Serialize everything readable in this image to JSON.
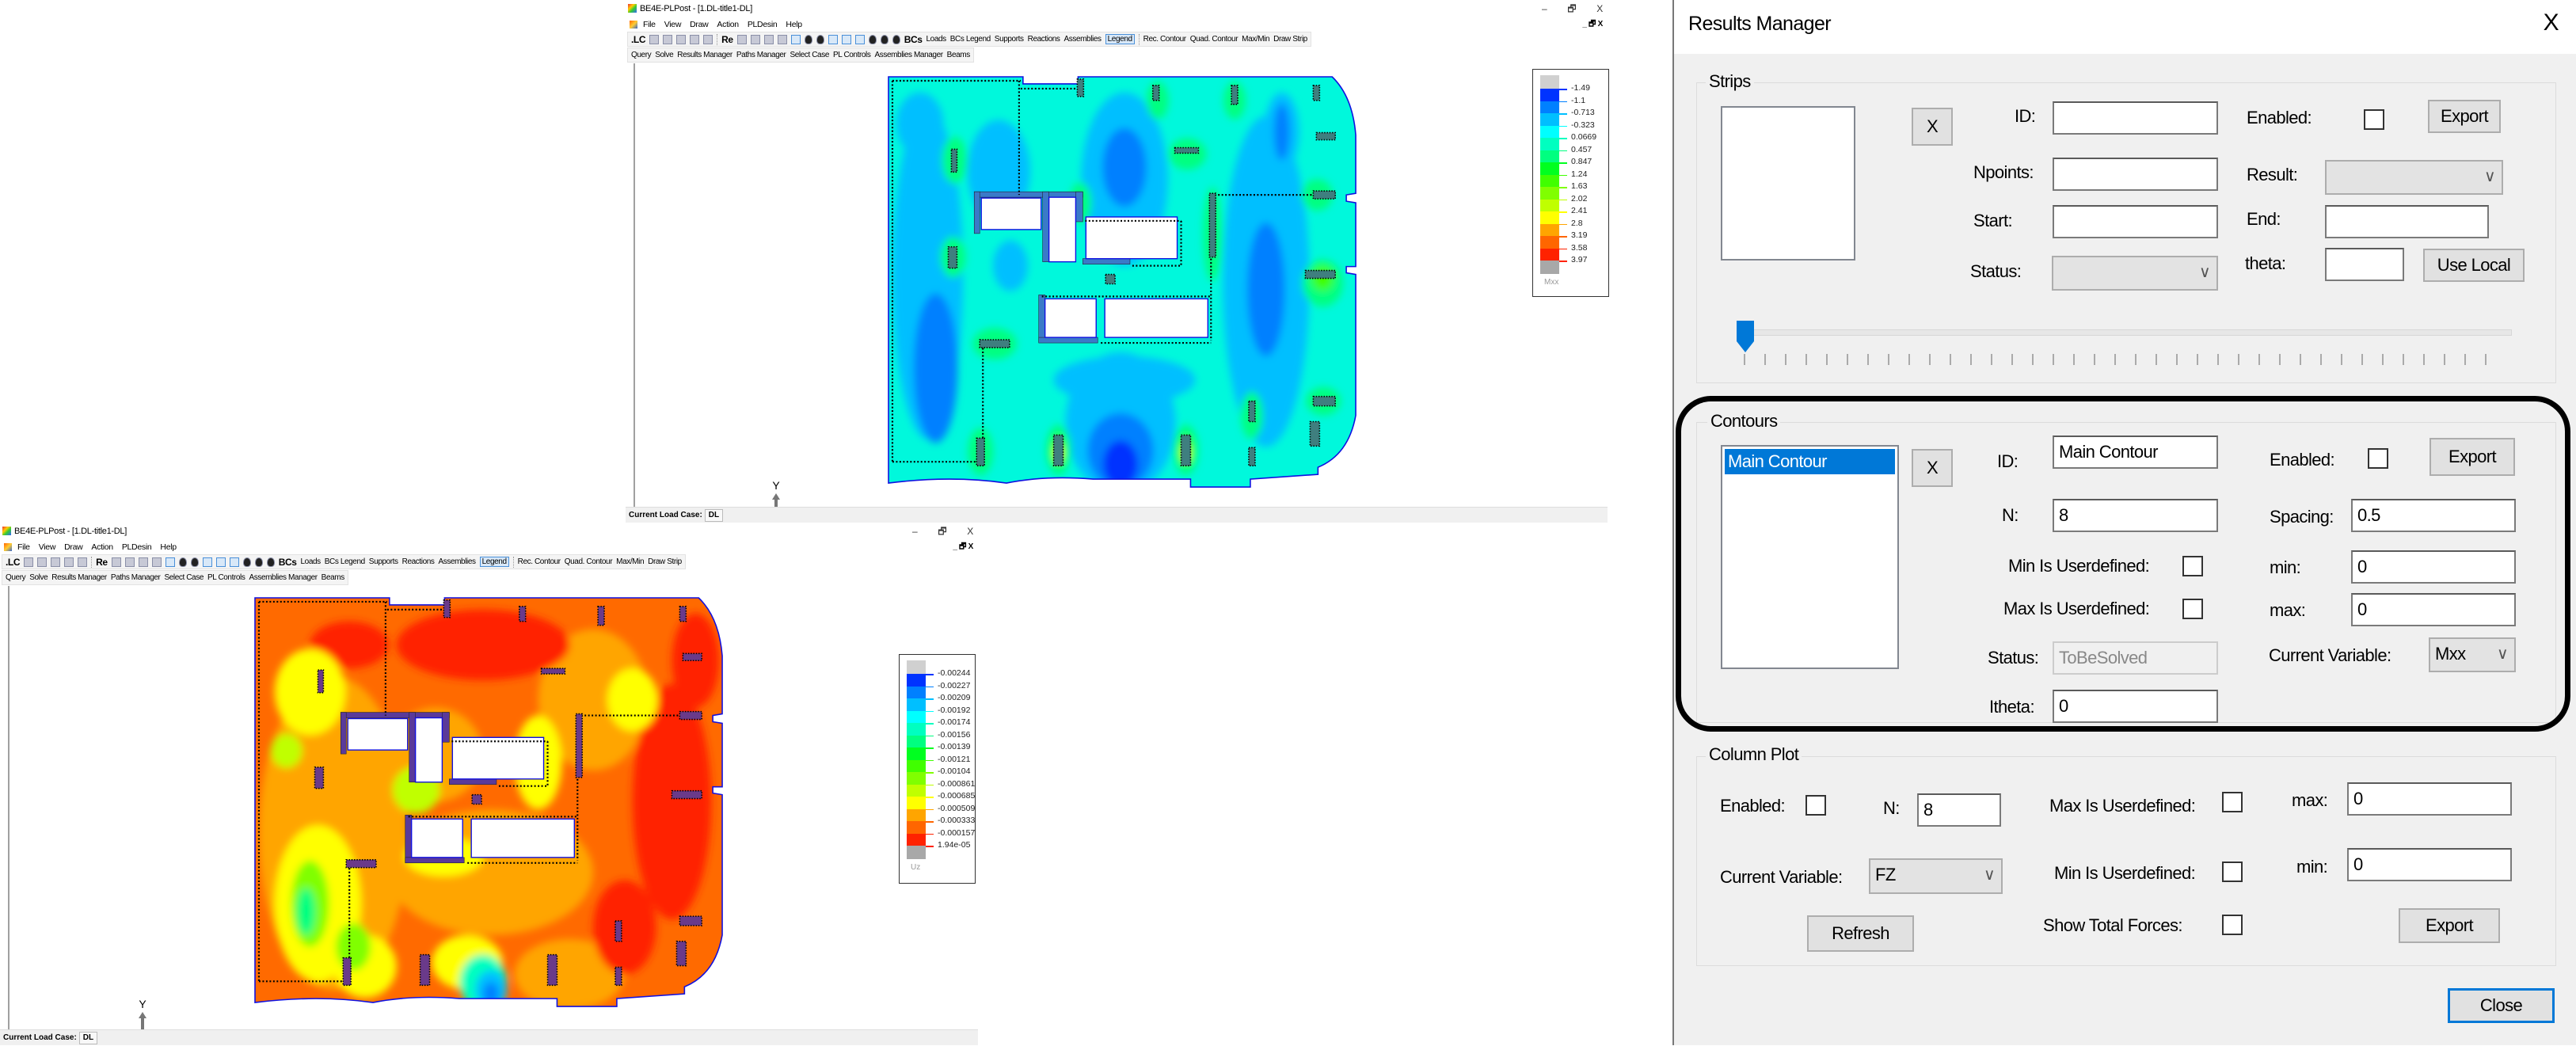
{
  "windows": [
    {
      "title": "BE4E-PLPost - [1.DL-title1-DL]",
      "controls": [
        "–",
        "🗗",
        "X"
      ],
      "mdi_controls": "_ 🗗 X",
      "menu": [
        "File",
        "View",
        "Draw",
        "Action",
        "PLDesin",
        "Help"
      ],
      "toolbar1": [
        ".LC",
        "Re",
        "BCs",
        "Loads",
        "BCs Legend",
        "Supports",
        "Reactions",
        "Assemblies",
        "Legend",
        "Rec. Contour",
        "Quad. Contour",
        "Max/Min",
        "Draw Strip"
      ],
      "toolbar2": [
        "Query",
        "Solve",
        "Results Manager",
        "Paths Manager",
        "Select Case",
        "PL Controls",
        "Assemblies Manager",
        "Beams"
      ],
      "status_label": "Current Load Case:",
      "load_case": "DL",
      "axis_label": "Y",
      "legend": {
        "variable": "Mxx",
        "values": [
          "-1.49",
          "-1.1",
          "-0.713",
          "-0.323",
          "0.0669",
          "0.457",
          "0.847",
          "1.24",
          "1.63",
          "2.02",
          "2.41",
          "2.8",
          "3.19",
          "3.58",
          "3.97"
        ]
      }
    },
    {
      "title": "BE4E-PLPost - [1.DL-title1-DL]",
      "controls": [
        "–",
        "🗗",
        "X"
      ],
      "mdi_controls": "_ 🗗 X",
      "menu": [
        "File",
        "View",
        "Draw",
        "Action",
        "PLDesin",
        "Help"
      ],
      "toolbar1": [
        ".LC",
        "Re",
        "BCs",
        "Loads",
        "BCs Legend",
        "Supports",
        "Reactions",
        "Assemblies",
        "Legend",
        "Rec. Contour",
        "Quad. Contour",
        "Max/Min",
        "Draw Strip"
      ],
      "toolbar2": [
        "Query",
        "Solve",
        "Results Manager",
        "Paths Manager",
        "Select Case",
        "PL Controls",
        "Assemblies Manager",
        "Beams"
      ],
      "status_label": "Current Load Case:",
      "load_case": "DL",
      "axis_label": "Y",
      "legend": {
        "variable": "Uz",
        "values": [
          "-0.00244",
          "-0.00227",
          "-0.00209",
          "-0.00192",
          "-0.00174",
          "-0.00156",
          "-0.00139",
          "-0.00121",
          "-0.00104",
          "-0.000861",
          "-0.000685",
          "-0.000509",
          "-0.000333",
          "-0.000157",
          "1.94e-05"
        ]
      }
    }
  ],
  "legend_colors": [
    "#0033ff",
    "#0080ff",
    "#00bfff",
    "#00ffff",
    "#00ffc0",
    "#00ff80",
    "#00ff20",
    "#40ff00",
    "#80ff00",
    "#c0ff00",
    "#ffff00",
    "#ffa500",
    "#ff6600",
    "#ff2200"
  ],
  "legend_out_of_range_color": "#d0d0d0",
  "results_manager": {
    "title": "Results Manager",
    "close_x": "X",
    "strips": {
      "group": "Strips",
      "remove": "X",
      "id_label": "ID:",
      "id_value": "",
      "enabled_label": "Enabled:",
      "enabled": false,
      "export": "Export",
      "npoints_label": "Npoints:",
      "npoints_value": "",
      "result_label": "Result:",
      "result_value": "",
      "start_label": "Start:",
      "start_value": "",
      "end_label": "End:",
      "end_value": "",
      "status_label": "Status:",
      "status_value": "",
      "theta_label": "theta:",
      "theta_value": "",
      "use_local": "Use Local",
      "slider_position": 0
    },
    "contours": {
      "group": "Contours",
      "items": [
        "Main Contour"
      ],
      "remove": "X",
      "id_label": "ID:",
      "id_value": "Main Contour",
      "enabled_label": "Enabled:",
      "enabled": false,
      "export": "Export",
      "n_label": "N:",
      "n_value": "8",
      "spacing_label": "Spacing:",
      "spacing_value": "0.5",
      "min_user_label": "Min Is Userdefined:",
      "min_user": false,
      "min_label": "min:",
      "min_value": "0",
      "max_user_label": "Max Is Userdefined:",
      "max_user": false,
      "max_label": "max:",
      "max_value": "0",
      "status_label": "Status:",
      "status_value": "ToBeSolved",
      "current_variable_label": "Current Variable:",
      "current_variable": "Mxx",
      "itheta_label": "Itheta:",
      "itheta_value": "0"
    },
    "column_plot": {
      "group": "Column Plot",
      "enabled_label": "Enabled:",
      "enabled": false,
      "n_label": "N:",
      "n_value": "8",
      "max_user_label": "Max Is Userdefined:",
      "max_user": false,
      "max_label": "max:",
      "max_value": "0",
      "current_variable_label": "Current Variable:",
      "current_variable": "FZ",
      "min_user_label": "Min Is Userdefined:",
      "min_user": false,
      "min_label": "min:",
      "min_value": "0",
      "refresh": "Refresh",
      "show_total_label": "Show Total Forces:",
      "show_total": false,
      "export": "Export"
    },
    "close": "Close"
  }
}
